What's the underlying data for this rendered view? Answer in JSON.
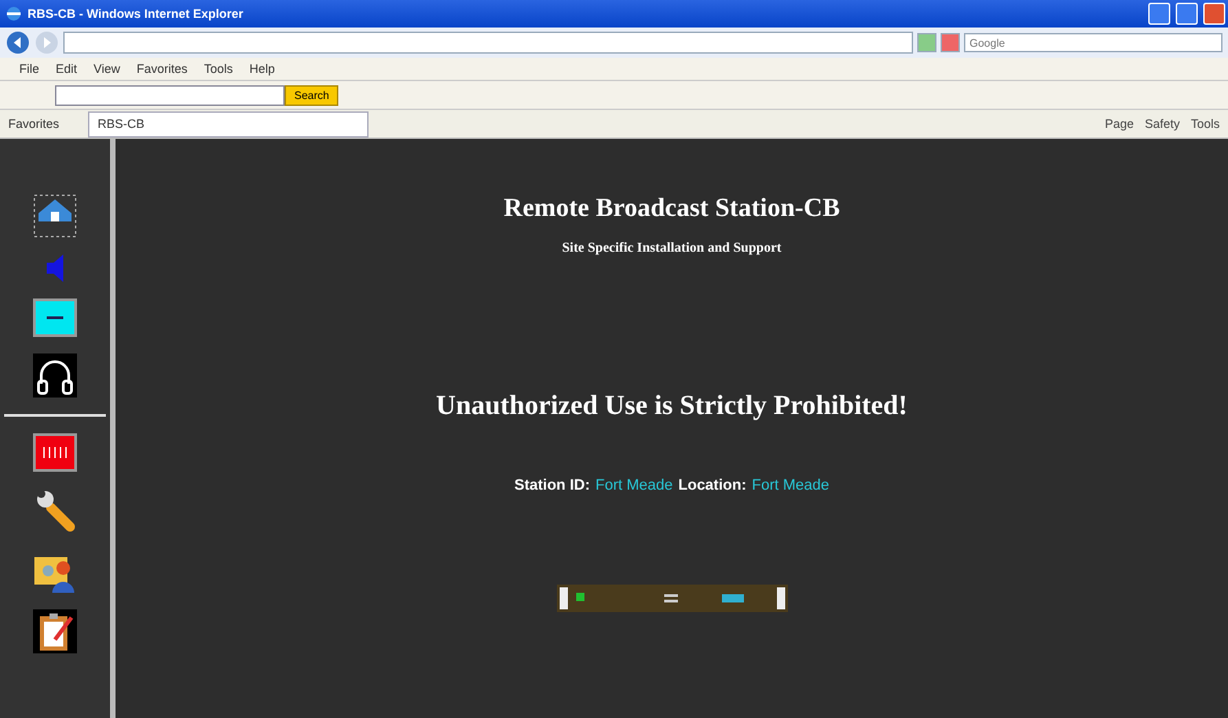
{
  "window": {
    "title": "RBS-CB - Windows Internet Explorer"
  },
  "menu": [
    "File",
    "Edit",
    "View",
    "Favorites",
    "Tools",
    "Help"
  ],
  "toolbar": {
    "search_button": "Search"
  },
  "search": {
    "placeholder": "Google"
  },
  "favorites": {
    "label": "Favorites"
  },
  "tabs": [
    {
      "label": "RBS-CB",
      "selected": true
    }
  ],
  "commands": [
    "Page",
    "Safety",
    "Tools"
  ],
  "sidebar": {
    "items": [
      {
        "kind": "home"
      },
      {
        "kind": "speaker"
      },
      {
        "kind": "cyan"
      },
      {
        "kind": "headphones"
      },
      {
        "kind": "separator"
      },
      {
        "kind": "red"
      },
      {
        "kind": "wrench"
      },
      {
        "kind": "people"
      },
      {
        "kind": "clipboard"
      }
    ]
  },
  "page": {
    "title": "Remote Broadcast Station-CB",
    "subtitle": "Site Specific Installation and Support",
    "warning": "Unauthorized Use is Strictly Prohibited!",
    "station_label": "Station ID:",
    "station_value": "Fort Meade",
    "location_label": "Location:",
    "location_value": "Fort Meade"
  }
}
